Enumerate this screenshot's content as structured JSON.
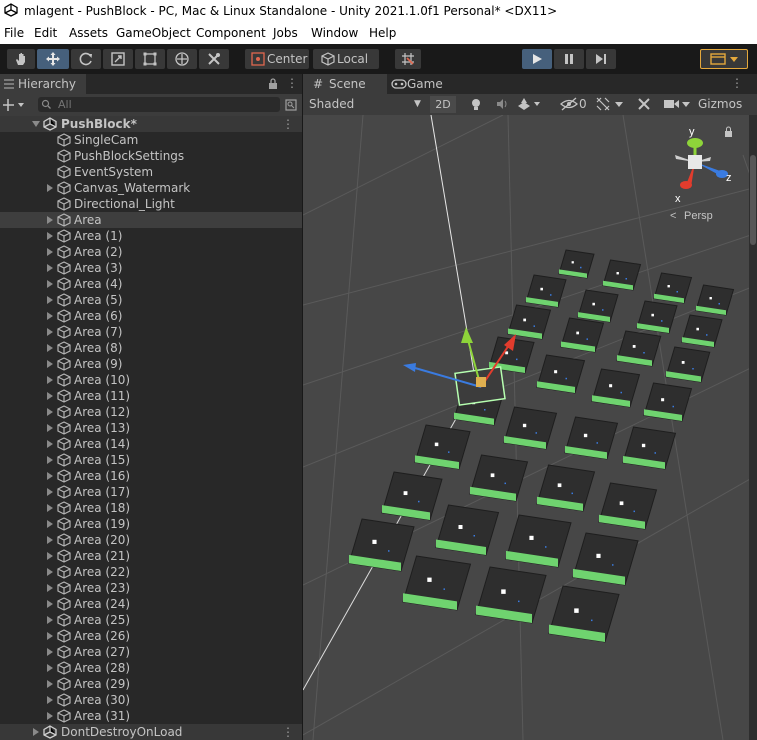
{
  "window": {
    "title": "mlagent - PushBlock - PC, Mac & Linux Standalone - Unity 2021.1.0f1 Personal* <DX11>"
  },
  "menu": [
    "File",
    "Edit",
    "Assets",
    "GameObject",
    "Component",
    "Jobs",
    "Window",
    "Help"
  ],
  "toolbar": {
    "tools": [
      "hand-tool",
      "move-tool",
      "rotate-tool",
      "scale-tool",
      "rect-tool",
      "transform-tool",
      "custom-tool"
    ],
    "pivot_label": "Center",
    "space_label": "Local",
    "playmode": [
      "play",
      "pause",
      "step"
    ]
  },
  "hierarchy": {
    "tab_label": "Hierarchy",
    "search_placeholder": "All",
    "scene_name": "PushBlock*",
    "children": [
      "SingleCam",
      "PushBlockSettings",
      "EventSystem",
      "Canvas_Watermark",
      "Directional_Light"
    ],
    "areas": [
      "Area",
      "Area (1)",
      "Area (2)",
      "Area (3)",
      "Area (4)",
      "Area (5)",
      "Area (6)",
      "Area (7)",
      "Area (8)",
      "Area (9)",
      "Area (10)",
      "Area (11)",
      "Area (12)",
      "Area (13)",
      "Area (14)",
      "Area (15)",
      "Area (16)",
      "Area (17)",
      "Area (18)",
      "Area (19)",
      "Area (20)",
      "Area (21)",
      "Area (22)",
      "Area (23)",
      "Area (24)",
      "Area (25)",
      "Area (26)",
      "Area (27)",
      "Area (28)",
      "Area (29)",
      "Area (30)",
      "Area (31)"
    ],
    "selected": "Area",
    "dont_destroy": "DontDestroyOnLoad"
  },
  "scene": {
    "tab_scene": "Scene",
    "tab_game": "Game",
    "draw_mode": "Shaded",
    "mode_2d": "2D",
    "hidden_count": "0",
    "gizmos_label": "Gizmos",
    "gizmo_y": "y",
    "gizmo_x": "x",
    "gizmo_z": "z",
    "projection": "Persp",
    "colors": {
      "background": "#474747",
      "floor": "#2e2e2e",
      "goal": "#6fd36f",
      "axis_x": "#e23c2d",
      "axis_y": "#8ed43a",
      "axis_z": "#3a7be0"
    }
  }
}
